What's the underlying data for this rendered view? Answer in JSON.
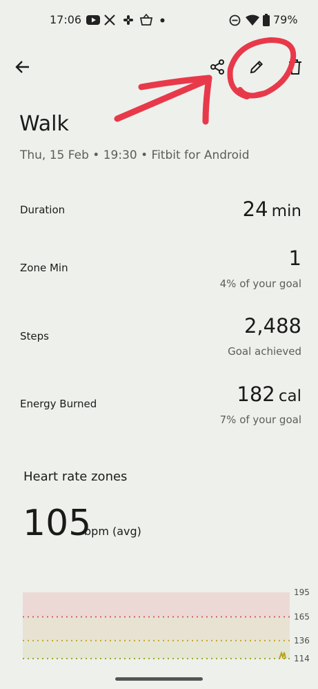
{
  "status_bar": {
    "time": "17:06",
    "battery": "79%",
    "icons": [
      "youtube-icon",
      "x-icon",
      "slack-icon",
      "shopping-basket-icon",
      "dot-icon",
      "do-not-disturb-icon",
      "wifi-icon",
      "battery-icon"
    ]
  },
  "toolbar": {
    "back_icon": "arrow-back-icon",
    "share_icon": "share-icon",
    "edit_icon": "pencil-icon",
    "delete_icon": "trash-icon",
    "annotation_color": "#e8394a"
  },
  "activity": {
    "title": "Walk",
    "subtitle": "Thu, 15 Feb • 19:30 • Fitbit for Android"
  },
  "stats": {
    "duration": {
      "label": "Duration",
      "value": "24",
      "unit": "min"
    },
    "zone_min": {
      "label": "Zone Min",
      "value": "1",
      "sub": "4% of your goal"
    },
    "steps": {
      "label": "Steps",
      "value": "2,488",
      "sub": "Goal achieved"
    },
    "energy": {
      "label": "Energy Burned",
      "value": "182",
      "unit": "cal",
      "sub": "7% of your goal"
    }
  },
  "heart_rate": {
    "heading": "Heart rate zones",
    "avg_value": "105",
    "avg_unit": "bpm (avg)"
  },
  "chart_data": {
    "type": "area",
    "y_ticks": [
      195,
      165,
      136,
      114
    ],
    "ylim": [
      114,
      195
    ],
    "zone_lines": [
      {
        "value": 165,
        "color": "#d65b5b"
      },
      {
        "value": 136,
        "color": "#c9a227"
      },
      {
        "value": 114,
        "color": "#9aa531"
      }
    ],
    "colors": {
      "peak_zone": "#ecd9d6",
      "cardio_zone": "#e8e2d2",
      "fat_burn_zone": "#e5e6d3"
    }
  }
}
